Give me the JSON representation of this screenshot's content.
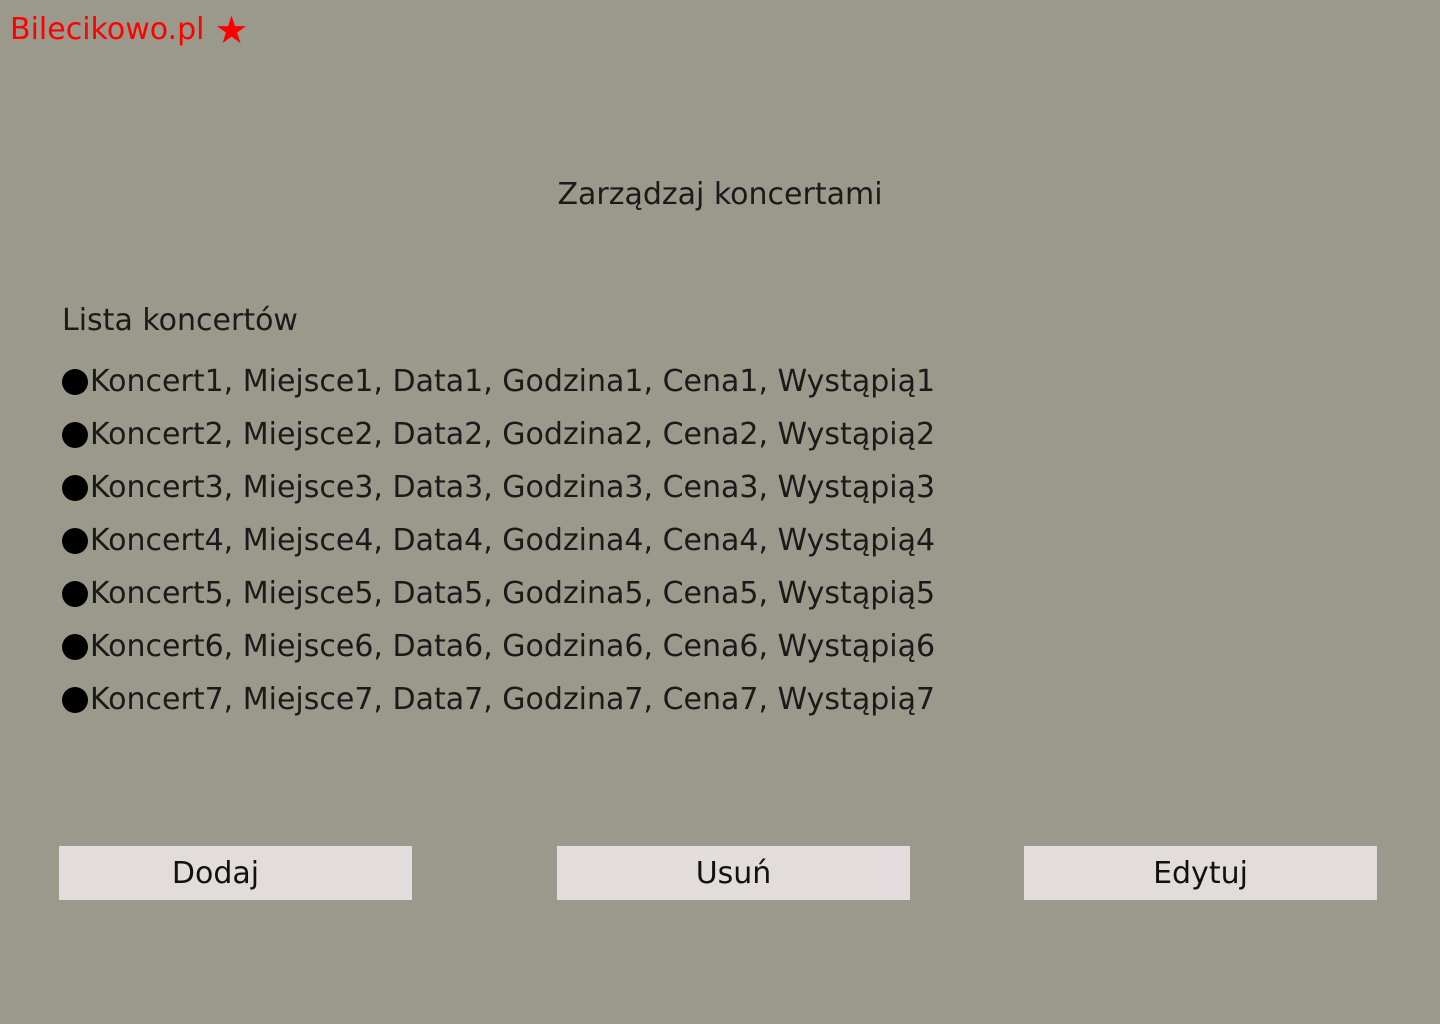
{
  "brand": {
    "name": "Bilecikowo.pl",
    "star_glyph": "★",
    "color": "#ff0000"
  },
  "page": {
    "title": "Zarządzaj koncertami",
    "background": "#9a998c"
  },
  "concerts": {
    "heading": "Lista koncertów",
    "items": [
      "Koncert1, Miejsce1, Data1, Godzina1, Cena1, Wystąpią1",
      "Koncert2, Miejsce2, Data2, Godzina2, Cena2, Wystąpią2",
      "Koncert3, Miejsce3, Data3, Godzina3, Cena3, Wystąpią3",
      "Koncert4, Miejsce4, Data4, Godzina4, Cena4, Wystąpią4",
      "Koncert5, Miejsce5, Data5, Godzina5, Cena5, Wystąpią5",
      "Koncert6, Miejsce6, Data6, Godzina6, Cena6, Wystąpią6",
      "Koncert7, Miejsce7, Data7, Godzina7, Cena7, Wystąpią7"
    ]
  },
  "actions": {
    "add_label": "Dodaj",
    "remove_label": "Usuń",
    "edit_label": "Edytuj",
    "button_color": "#e3dcdc"
  }
}
